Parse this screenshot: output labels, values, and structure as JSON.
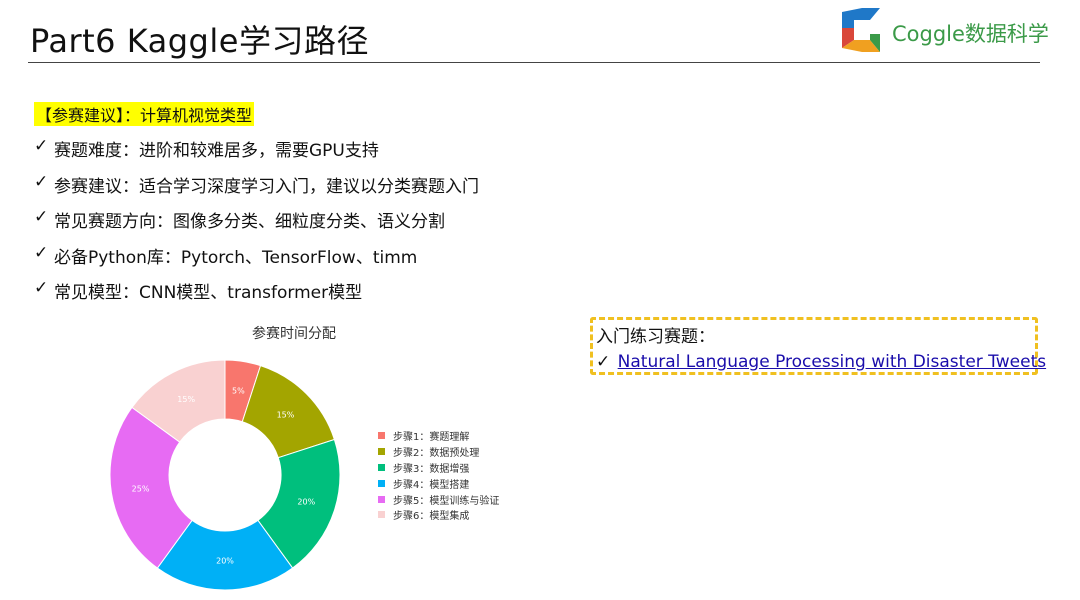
{
  "slide": {
    "title": "Part6 Kaggle学习路径"
  },
  "brand": {
    "name": "Coggle数据科学",
    "colors": {
      "orange": "#f0a020",
      "green": "#3b9a48",
      "blue": "#1f78c8",
      "red": "#d9473a"
    }
  },
  "section": {
    "title": "【参赛建议】：计算机视觉类型"
  },
  "bullets": [
    {
      "check": "✓",
      "text": "赛题难度：进阶和较难居多，需要GPU支持"
    },
    {
      "check": "✓",
      "text": "参赛建议：适合学习深度学习入门，建议以分类赛题入门"
    },
    {
      "check": "✓",
      "text": "常见赛题方向：图像多分类、细粒度分类、语义分割"
    },
    {
      "check": "✓",
      "text": "必备Python库：Pytorch、TensorFlow、timm"
    },
    {
      "check": "✓",
      "text": "常见模型：CNN模型、transformer模型"
    }
  ],
  "practice": {
    "title": "入门练习赛题：",
    "check": "✓",
    "link_text": "Natural Language Processing with Disaster Tweets"
  },
  "chart_data": {
    "type": "pie",
    "title": "参赛时间分配",
    "donut": true,
    "legend_position": "right",
    "categories": [
      "步骤1：赛题理解",
      "步骤2：数据预处理",
      "步骤3：数据增强",
      "步骤4：模型搭建",
      "步骤5：模型训练与验证",
      "步骤6：模型集成"
    ],
    "values": [
      5,
      15,
      20,
      20,
      25,
      15
    ],
    "labels": [
      "5%",
      "15%",
      "20%",
      "20%",
      "25%",
      "15%"
    ],
    "colors": [
      "#f8766d",
      "#a3a500",
      "#00bf7d",
      "#00b0f6",
      "#e76bf3",
      "#f9d1d1"
    ]
  }
}
